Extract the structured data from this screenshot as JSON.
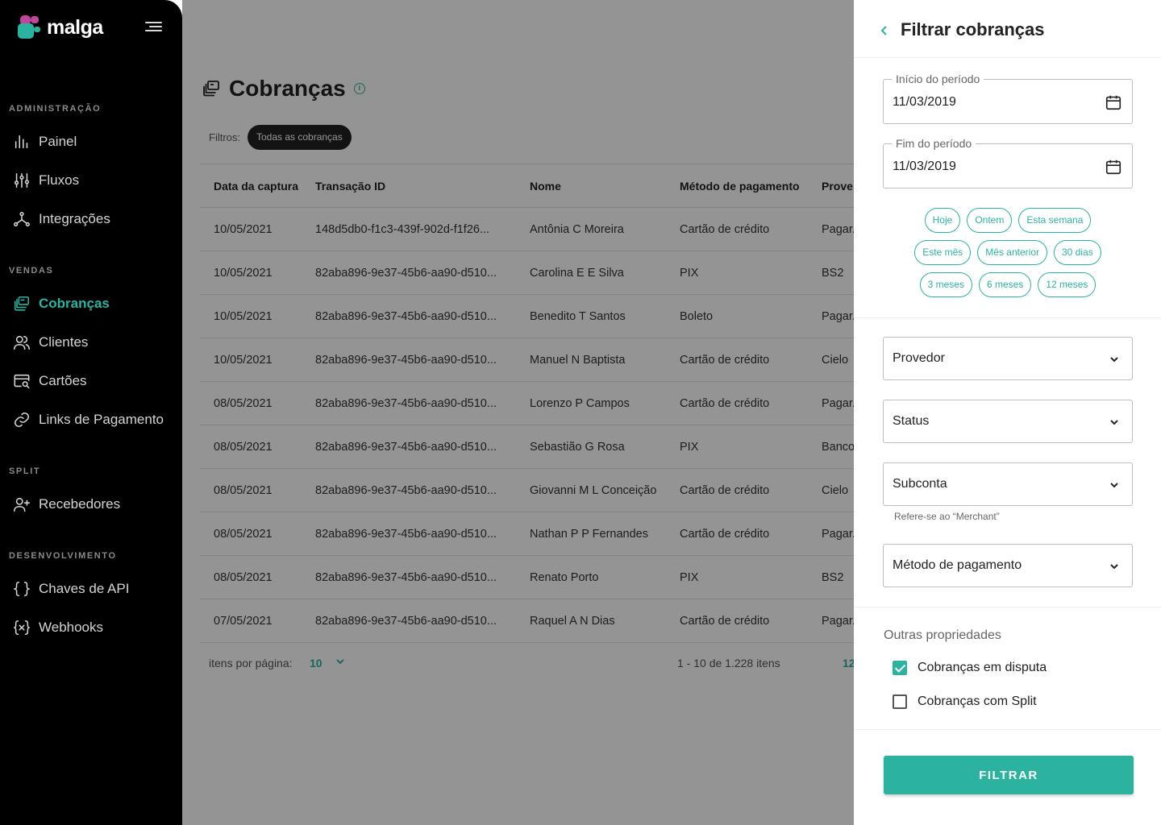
{
  "brand": {
    "name": "malga",
    "accent": "#2bb3a0"
  },
  "sidebar": {
    "sections": [
      {
        "title": "ADMINISTRAÇÃO"
      },
      {
        "title": "VENDAS"
      },
      {
        "title": "SPLIT"
      },
      {
        "title": "DESENVOLVIMENTO"
      }
    ],
    "items": [
      {
        "label": "Painel",
        "icon": "bar-chart-icon"
      },
      {
        "label": "Fluxos",
        "icon": "sliders-icon"
      },
      {
        "label": "Integrações",
        "icon": "network-icon"
      },
      {
        "label": "Cobranças",
        "icon": "charges-icon",
        "active": true
      },
      {
        "label": "Clientes",
        "icon": "users-icon"
      },
      {
        "label": "Cartões",
        "icon": "card-search-icon"
      },
      {
        "label": "Links de Pagamento",
        "icon": "link-icon"
      },
      {
        "label": "Recebedores",
        "icon": "user-plus-icon"
      },
      {
        "label": "Chaves de API",
        "icon": "braces-icon"
      },
      {
        "label": "Webhooks",
        "icon": "webhook-icon"
      }
    ]
  },
  "page": {
    "title": "Cobranças",
    "filters_label": "Filtros:",
    "active_filter": "Todas as cobranças"
  },
  "table": {
    "headers": [
      "Data da captura",
      "Transação ID",
      "Nome",
      "Método de pagamento",
      "Prove"
    ],
    "rows": [
      [
        "10/05/2021",
        "148d5db0-f1c3-439f-902d-f1f26...",
        "Antônia C Moreira",
        "Cartão de crédito",
        "Pagar."
      ],
      [
        "10/05/2021",
        "82aba896-9e37-45b6-aa90-d510...",
        "Carolina E E Silva",
        "PIX",
        "BS2"
      ],
      [
        "10/05/2021",
        "82aba896-9e37-45b6-aa90-d510...",
        "Benedito T Santos",
        "Boleto",
        "Pagar."
      ],
      [
        "10/05/2021",
        "82aba896-9e37-45b6-aa90-d510...",
        "Manuel N Baptista",
        "Cartão de crédito",
        "Cielo"
      ],
      [
        "08/05/2021",
        "82aba896-9e37-45b6-aa90-d510...",
        "Lorenzo P Campos",
        "Cartão de crédito",
        "Pagar."
      ],
      [
        "08/05/2021",
        "82aba896-9e37-45b6-aa90-d510...",
        "Sebastião G Rosa",
        "PIX",
        "Banco"
      ],
      [
        "08/05/2021",
        "82aba896-9e37-45b6-aa90-d510...",
        "Giovanni M L Conceição",
        "Cartão de crédito",
        "Cielo"
      ],
      [
        "08/05/2021",
        "82aba896-9e37-45b6-aa90-d510...",
        "Nathan P P Fernandes",
        "Cartão de crédito",
        "Pagar."
      ],
      [
        "08/05/2021",
        "82aba896-9e37-45b6-aa90-d510...",
        "Renato Porto",
        "PIX",
        "BS2"
      ],
      [
        "07/05/2021",
        "82aba896-9e37-45b6-aa90-d510...",
        "Raquel A N Dias",
        "Cartão de crédito",
        "Pagar."
      ]
    ]
  },
  "pagination": {
    "per_page_label": "itens por página:",
    "per_page_value": "10",
    "range": "1 - 10 de 1.228 itens",
    "page_partial": "12"
  },
  "drawer": {
    "title": "Filtrar cobranças",
    "start": {
      "label": "Início do período",
      "value": "11/03/2019"
    },
    "end": {
      "label": "Fim do período",
      "value": "11/03/2019"
    },
    "quick_rows": [
      [
        "Hoje",
        "Ontem",
        "Esta semana"
      ],
      [
        "Este mês",
        "Mês anterior",
        "30 dias"
      ],
      [
        "3 meses",
        "6 meses",
        "12 meses"
      ]
    ],
    "selects": {
      "provider": "Provedor",
      "status": "Status",
      "subaccount": "Subconta",
      "subaccount_helper": "Refere-se ao “Merchant”",
      "method": "Método de pagamento"
    },
    "other_title": "Outras propriedades",
    "checks": [
      {
        "label": "Cobranças em disputa",
        "checked": true
      },
      {
        "label": "Cobranças com Split",
        "checked": false
      }
    ],
    "submit_label": "FILTRAR"
  }
}
